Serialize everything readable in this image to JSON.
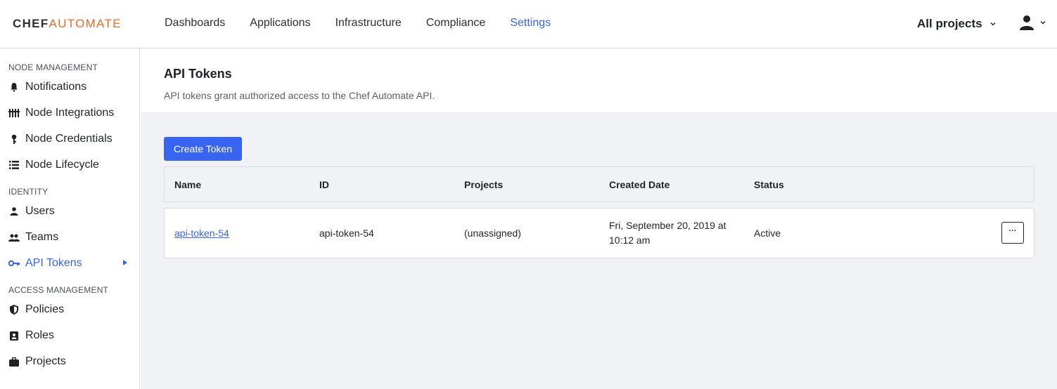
{
  "logo": {
    "part1": "CHEF",
    "part2": "AUTOMATE"
  },
  "nav": [
    {
      "label": "Dashboards"
    },
    {
      "label": "Applications"
    },
    {
      "label": "Infrastructure"
    },
    {
      "label": "Compliance"
    },
    {
      "label": "Settings"
    }
  ],
  "projects_filter": {
    "label": "All projects"
  },
  "sidebar": {
    "sections": [
      {
        "title": "NODE MANAGEMENT"
      },
      {
        "title": "IDENTITY"
      },
      {
        "title": "ACCESS MANAGEMENT"
      }
    ],
    "items": [
      {
        "label": "Notifications",
        "icon": "bell-icon"
      },
      {
        "label": "Node Integrations",
        "icon": "integrations-icon"
      },
      {
        "label": "Node Credentials",
        "icon": "key-icon"
      },
      {
        "label": "Node Lifecycle",
        "icon": "list-icon"
      },
      {
        "label": "Users",
        "icon": "person-icon"
      },
      {
        "label": "Teams",
        "icon": "people-icon"
      },
      {
        "label": "API Tokens",
        "icon": "vpn-key-icon",
        "active": true
      },
      {
        "label": "Policies",
        "icon": "shield-icon"
      },
      {
        "label": "Roles",
        "icon": "badge-icon"
      },
      {
        "label": "Projects",
        "icon": "briefcase-icon"
      }
    ]
  },
  "page": {
    "title": "API Tokens",
    "subtitle": "API tokens grant authorized access to the Chef Automate API.",
    "create_label": "Create Token"
  },
  "table": {
    "columns": [
      "Name",
      "ID",
      "Projects",
      "Created Date",
      "Status"
    ],
    "rows": [
      {
        "name": "api-token-54",
        "id": "api-token-54",
        "projects": "(unassigned)",
        "created_line1": "Fri, September 20, 2019 at",
        "created_line2": "10:12 am",
        "status": "Active",
        "menu": "···"
      }
    ]
  },
  "colors": {
    "accent": "#3864f2",
    "brand_orange": "#f26a23",
    "content_bg": "#f0f2f5"
  }
}
